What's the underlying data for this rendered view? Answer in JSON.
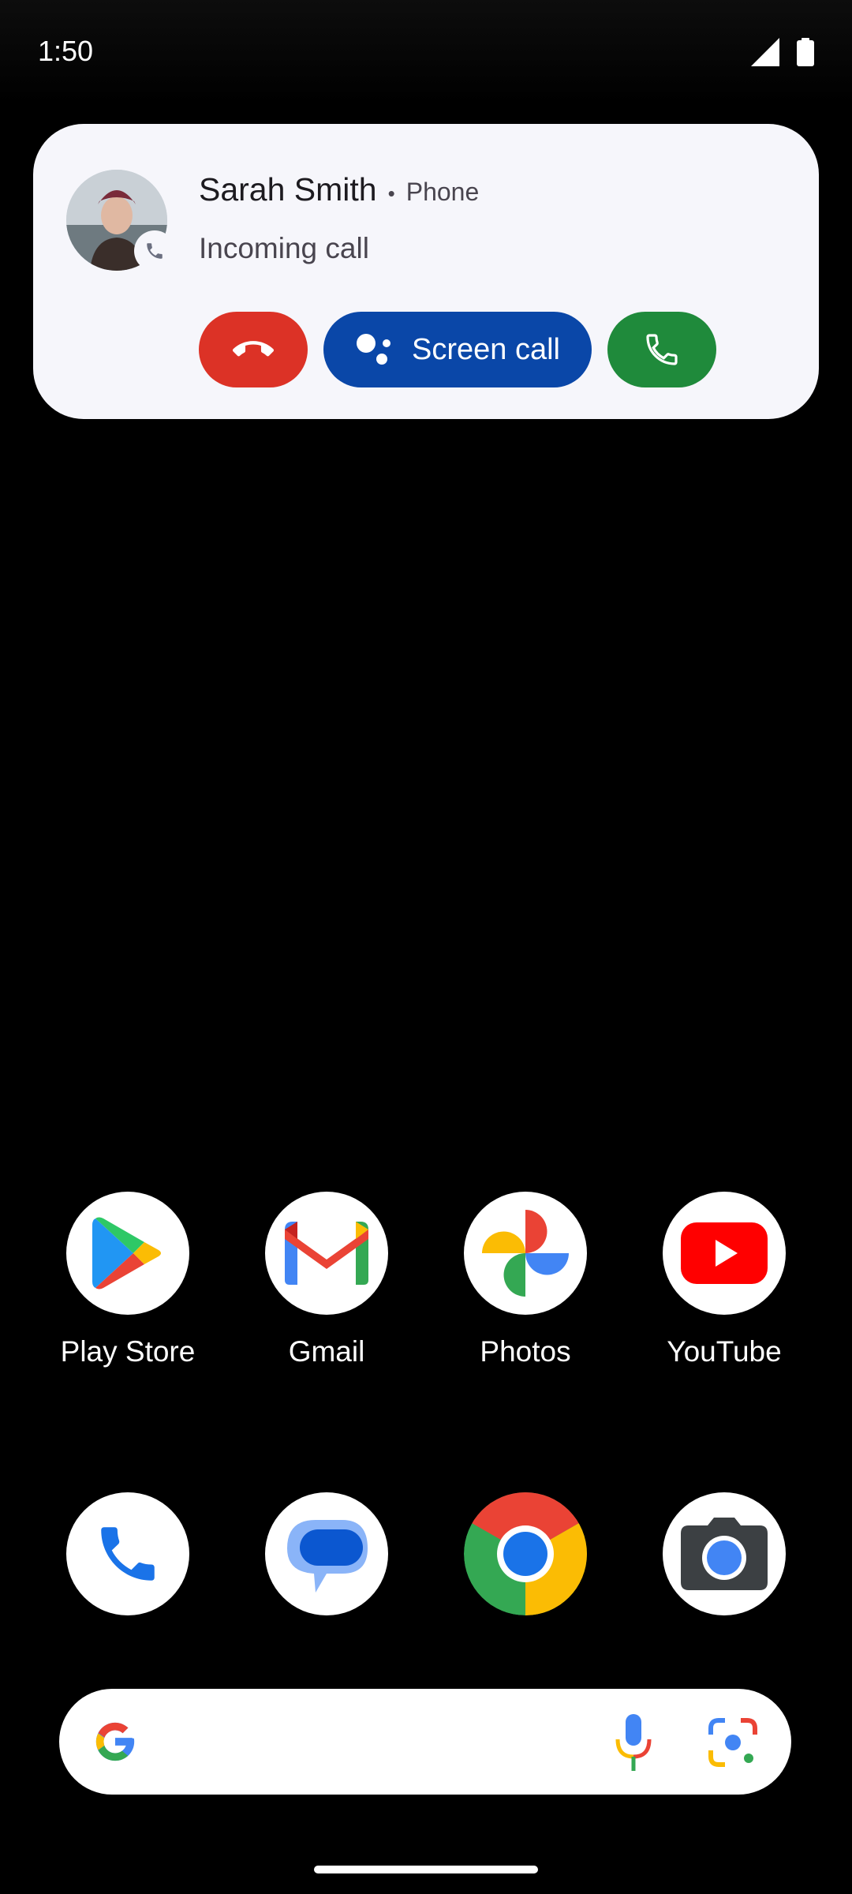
{
  "status_bar": {
    "time": "1:50",
    "icons": [
      "signal-icon",
      "battery-icon"
    ]
  },
  "notification": {
    "caller_name": "Sarah Smith",
    "separator": "•",
    "app_name": "Phone",
    "status_text": "Incoming call",
    "actions": {
      "decline_icon": "hang-up-icon",
      "screen_call_label": "Screen call",
      "answer_icon": "phone-icon"
    }
  },
  "home": {
    "row1": [
      {
        "label": "Play Store",
        "icon": "play-store-icon"
      },
      {
        "label": "Gmail",
        "icon": "gmail-icon"
      },
      {
        "label": "Photos",
        "icon": "photos-icon"
      },
      {
        "label": "YouTube",
        "icon": "youtube-icon"
      }
    ],
    "dock": [
      {
        "icon": "phone-app-icon"
      },
      {
        "icon": "messages-icon"
      },
      {
        "icon": "chrome-icon"
      },
      {
        "icon": "camera-icon"
      }
    ]
  },
  "search_bar": {
    "icons": [
      "google-g-icon",
      "microphone-icon",
      "lens-icon"
    ]
  },
  "colors": {
    "decline": "#dc3226",
    "screen_call": "#0a47a8",
    "answer": "#1f8a3b",
    "notification_bg": "#f6f6fb"
  }
}
